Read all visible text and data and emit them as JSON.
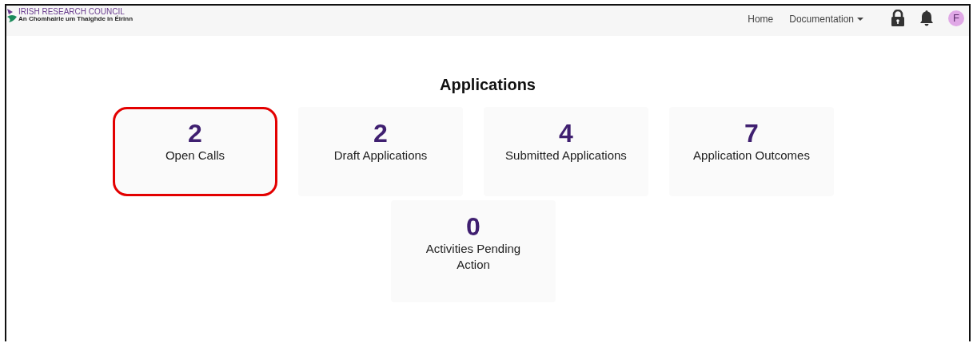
{
  "logo": {
    "title": "IRISH RESEARCH COUNCIL",
    "subtitle": "An Chomhairle um Thaighde in Éirinn"
  },
  "nav": [
    {
      "label": "Home",
      "dropdown": false
    },
    {
      "label": "Documentation",
      "dropdown": true
    }
  ],
  "avatar": "F",
  "heading": "Applications",
  "tiles": [
    {
      "count": "2",
      "label": "Open Calls",
      "highlighted": true
    },
    {
      "count": "2",
      "label": "Draft Applications",
      "highlighted": false
    },
    {
      "count": "4",
      "label": "Submitted Applications",
      "highlighted": false
    },
    {
      "count": "7",
      "label": "Application Outcomes",
      "highlighted": false
    },
    {
      "count": "0",
      "label": "Activities Pending Action",
      "highlighted": false
    }
  ]
}
